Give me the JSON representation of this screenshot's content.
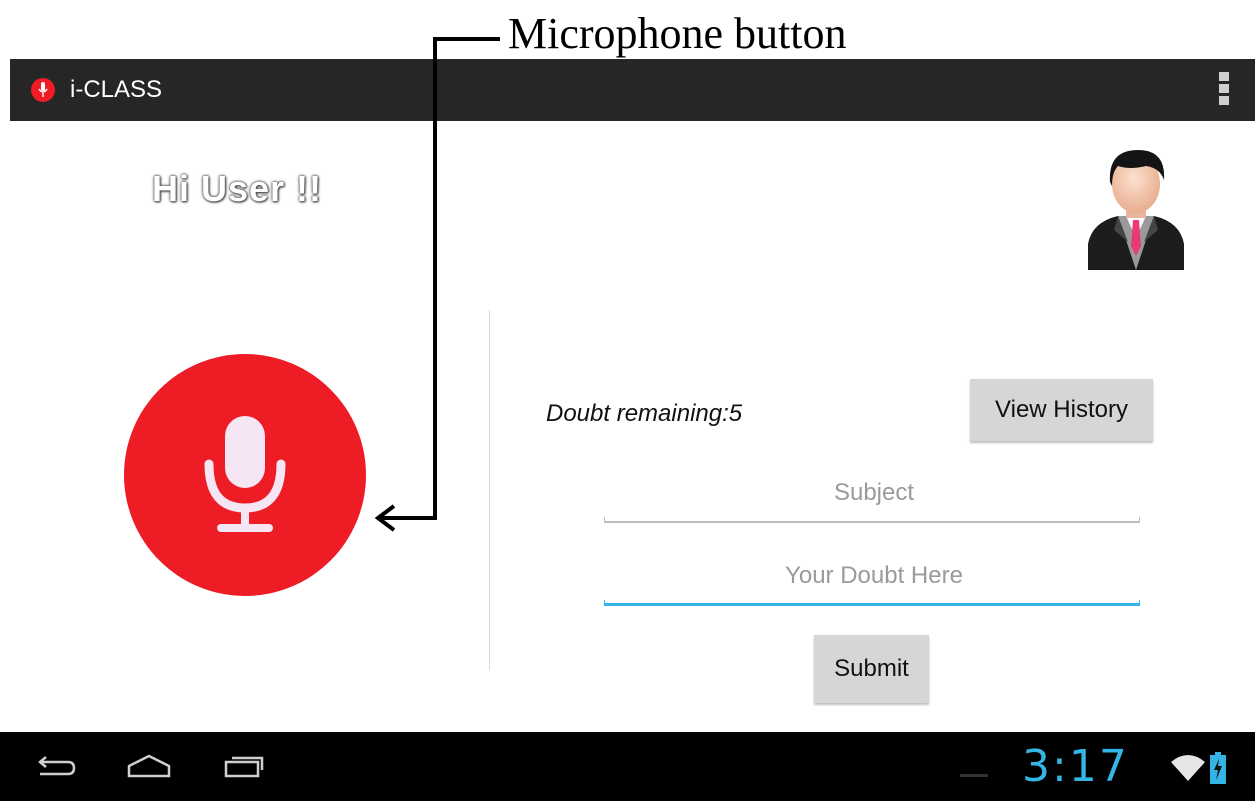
{
  "annotation": {
    "caption": "Microphone button"
  },
  "action_bar": {
    "title": "i-CLASS",
    "icon": "mic-icon",
    "overflow": "overflow-menu-icon"
  },
  "main": {
    "greeting": "Hi User !!",
    "avatar": "user-avatar-icon",
    "mic_button": "mic-icon",
    "doubt_remaining": "Doubt remaining:5",
    "view_history_label": "View History",
    "subject_placeholder": "Subject",
    "doubt_placeholder": "Your Doubt Here",
    "submit_label": "Submit"
  },
  "system_bar": {
    "time": "3:17",
    "icons": [
      "back-icon",
      "home-icon",
      "recents-icon",
      "wifi-icon",
      "battery-charging-icon"
    ]
  },
  "colors": {
    "accent_red": "#ee1c25",
    "action_bar": "#262626",
    "holo_blue": "#33b5e5",
    "button_gray": "#d6d6d6"
  }
}
